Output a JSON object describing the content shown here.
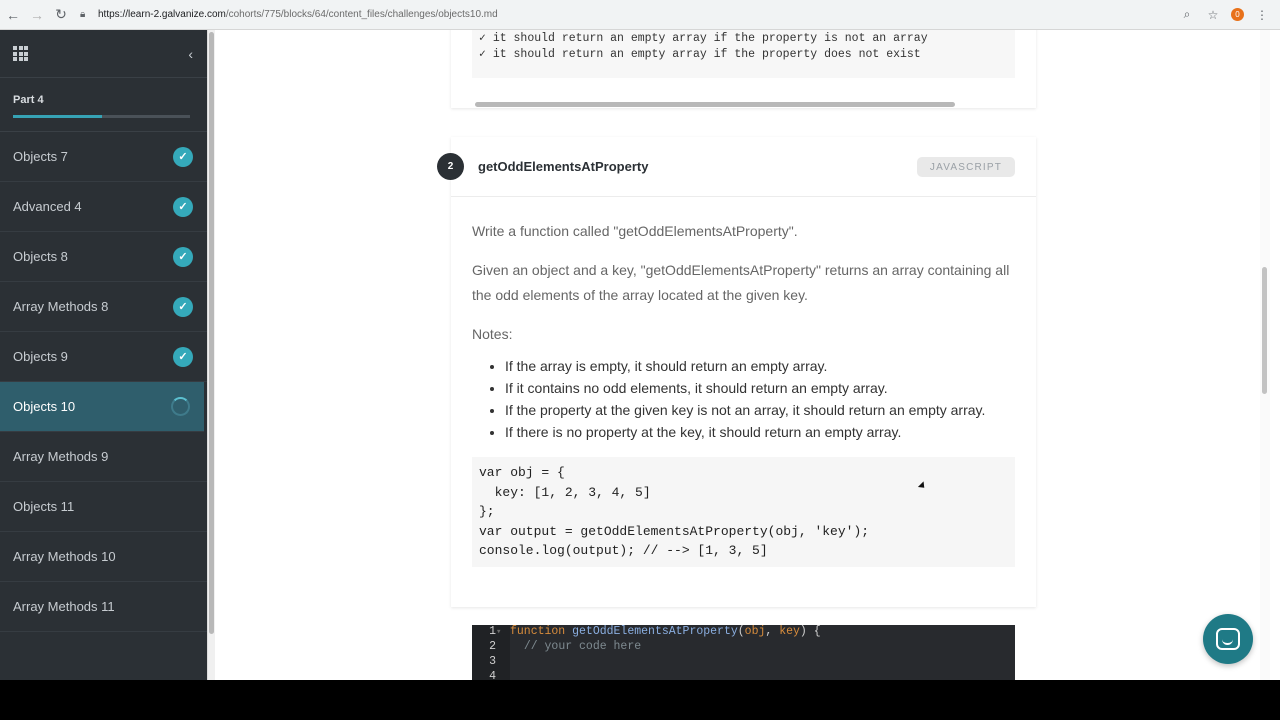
{
  "browser": {
    "url_host": "https://learn-2.galvanize.com",
    "url_path": "/cohorts/775/blocks/64/content_files/challenges/objects10.md",
    "extension_badge": "0"
  },
  "sidebar": {
    "part_label": "Part 4",
    "progress": 0.5,
    "items": [
      {
        "label": "Objects 7",
        "status": "complete"
      },
      {
        "label": "Advanced 4",
        "status": "complete"
      },
      {
        "label": "Objects 8",
        "status": "complete"
      },
      {
        "label": "Array Methods 8",
        "status": "complete"
      },
      {
        "label": "Objects 9",
        "status": "complete"
      },
      {
        "label": "Objects 10",
        "status": "in-progress"
      },
      {
        "label": "Array Methods 9",
        "status": "none"
      },
      {
        "label": "Objects 11",
        "status": "none"
      },
      {
        "label": "Array Methods 10",
        "status": "none"
      },
      {
        "label": "Array Methods 11",
        "status": "none"
      }
    ]
  },
  "prev_tests": [
    "✓ it should return an empty array if the property is not an array",
    "✓ it should return an empty array if the property does not exist"
  ],
  "challenge": {
    "number": "2",
    "title": "getOddElementsAtProperty",
    "language": "JAVASCRIPT",
    "intro": "Write a function called \"getOddElementsAtProperty\".",
    "description": "Given an object and a key, \"getOddElementsAtProperty\" returns an array containing all the odd elements of the array located at the given key.",
    "notes_label": "Notes:",
    "notes": [
      "If the array is empty, it should return an empty array.",
      "If it contains no odd elements, it should return an empty array.",
      "If the property at the given key is not an array, it should return an empty array.",
      "If there is no property at the key, it should return an empty array."
    ],
    "example_code": [
      "var obj = {",
      "  key: [1, 2, 3, 4, 5]",
      "};",
      "var output = getOddElementsAtProperty(obj, 'key');",
      "console.log(output); // --> [1, 3, 5]"
    ]
  },
  "editor": {
    "line_numbers": [
      "1",
      "2",
      "3",
      "4"
    ],
    "keyword": "function",
    "fn_name": "getOddElementsAtProperty",
    "arg1": "obj",
    "arg2": "key",
    "comment": "// your code here"
  },
  "colors": {
    "sidebar_bg": "#2b3035",
    "accent": "#35a9ba",
    "active_item_bg": "#2f5e6c",
    "chat_button": "#1f7a86"
  }
}
